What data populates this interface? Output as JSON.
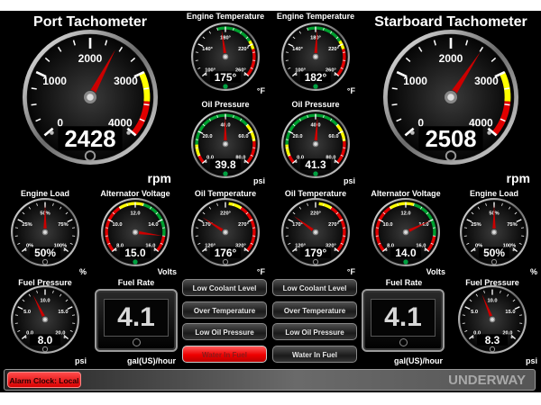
{
  "gauges": [
    {
      "id": "port-tachometer",
      "title": "Port Tachometer",
      "unit": "rpm",
      "min": 0,
      "max": 4000,
      "labels": [
        "0",
        "1000",
        "2000",
        "3000",
        "4000"
      ],
      "value": 2428,
      "readout": "2428",
      "indicator": "off",
      "bands": [
        {
          "from": 3000,
          "to": 3450,
          "color": "#ffff00"
        },
        {
          "from": 3450,
          "to": 4000,
          "color": "#e00000"
        }
      ]
    },
    {
      "id": "starboard-tachometer",
      "title": "Starboard Tachometer",
      "unit": "rpm",
      "min": 0,
      "max": 4000,
      "labels": [
        "0",
        "1000",
        "2000",
        "3000",
        "4000"
      ],
      "value": 2508,
      "readout": "2508",
      "indicator": "off",
      "bands": [
        {
          "from": 3000,
          "to": 3450,
          "color": "#ffff00"
        },
        {
          "from": 3450,
          "to": 4000,
          "color": "#e00000"
        }
      ]
    },
    {
      "id": "port-engine-temperature",
      "title": "Engine Temperature",
      "unit": "°F",
      "min": 100,
      "max": 260,
      "labels": [
        "100°",
        "140°",
        "180°",
        "220°",
        "260°"
      ],
      "value": 175,
      "readout": "175°",
      "indicator": "green",
      "bands": [
        {
          "from": 170,
          "to": 215,
          "color": "#00a030"
        },
        {
          "from": 215,
          "to": 226,
          "color": "#ffff00"
        },
        {
          "from": 226,
          "to": 260,
          "color": "#e00000"
        }
      ]
    },
    {
      "id": "starboard-engine-temperature",
      "title": "Engine Temperature",
      "unit": "°F",
      "min": 100,
      "max": 260,
      "labels": [
        "100°",
        "140°",
        "180°",
        "220°",
        "260°"
      ],
      "value": 182,
      "readout": "182°",
      "indicator": "green",
      "bands": [
        {
          "from": 170,
          "to": 215,
          "color": "#00a030"
        },
        {
          "from": 215,
          "to": 226,
          "color": "#ffff00"
        },
        {
          "from": 226,
          "to": 260,
          "color": "#e00000"
        }
      ]
    },
    {
      "id": "port-oil-pressure",
      "title": "Oil Pressure",
      "unit": "psi",
      "min": 0,
      "max": 80,
      "labels": [
        "0.0",
        "20.0",
        "40.0",
        "60.0",
        "80.0"
      ],
      "value": 39.8,
      "readout": "39.8",
      "indicator": "green",
      "bands": [
        {
          "from": 0,
          "to": 5,
          "color": "#e00000"
        },
        {
          "from": 5,
          "to": 12,
          "color": "#ffff00"
        },
        {
          "from": 12,
          "to": 55,
          "color": "#00a030"
        },
        {
          "from": 55,
          "to": 66,
          "color": "#ffff00"
        },
        {
          "from": 66,
          "to": 80,
          "color": "#e00000"
        }
      ]
    },
    {
      "id": "starboard-oil-pressure",
      "title": "Oil Pressure",
      "unit": "psi",
      "min": 0,
      "max": 80,
      "labels": [
        "0.0",
        "20.0",
        "40.0",
        "60.0",
        "80.0"
      ],
      "value": 41.3,
      "readout": "41.3",
      "indicator": "green",
      "bands": [
        {
          "from": 0,
          "to": 5,
          "color": "#e00000"
        },
        {
          "from": 5,
          "to": 12,
          "color": "#ffff00"
        },
        {
          "from": 12,
          "to": 55,
          "color": "#00a030"
        },
        {
          "from": 55,
          "to": 66,
          "color": "#ffff00"
        },
        {
          "from": 66,
          "to": 80,
          "color": "#e00000"
        }
      ]
    },
    {
      "id": "port-engine-load",
      "title": "Engine Load",
      "unit": "%",
      "min": 0,
      "max": 100,
      "labels": [
        "0%",
        "25%",
        "50%",
        "75%",
        "100%"
      ],
      "value": 50,
      "readout": "50%",
      "indicator": "off",
      "bands": []
    },
    {
      "id": "port-alternator-voltage",
      "title": "Alternator Voltage",
      "unit": "Volts",
      "min": 8,
      "max": 16,
      "labels": [
        "8.0",
        "10.0",
        "12.0",
        "14.0",
        "16.0"
      ],
      "value": 15.0,
      "readout": "15.0",
      "indicator": "green",
      "bands": [
        {
          "from": 8,
          "to": 11,
          "color": "#e00000"
        },
        {
          "from": 11,
          "to": 12.5,
          "color": "#ffff00"
        },
        {
          "from": 12.5,
          "to": 15,
          "color": "#00a030"
        },
        {
          "from": 15,
          "to": 16,
          "color": "#e00000"
        }
      ]
    },
    {
      "id": "port-oil-temperature",
      "title": "Oil Temperature",
      "unit": "°F",
      "min": 120,
      "max": 320,
      "labels": [
        "120°",
        "170°",
        "220°",
        "270°",
        "320°"
      ],
      "value": 176,
      "readout": "176°",
      "indicator": "off",
      "bands": [
        {
          "from": 225,
          "to": 245,
          "color": "#ffff00"
        },
        {
          "from": 245,
          "to": 320,
          "color": "#e00000"
        }
      ]
    },
    {
      "id": "starboard-oil-temperature",
      "title": "Oil Temperature",
      "unit": "°F",
      "min": 120,
      "max": 320,
      "labels": [
        "120°",
        "170°",
        "220°",
        "270°",
        "320°"
      ],
      "value": 179,
      "readout": "179°",
      "indicator": "off",
      "bands": [
        {
          "from": 225,
          "to": 245,
          "color": "#ffff00"
        },
        {
          "from": 245,
          "to": 320,
          "color": "#e00000"
        }
      ]
    },
    {
      "id": "starboard-alternator-voltage",
      "title": "Alternator Voltage",
      "unit": "Volts",
      "min": 8,
      "max": 16,
      "labels": [
        "8.0",
        "10.0",
        "12.0",
        "14.0",
        "16.0"
      ],
      "value": 14.0,
      "readout": "14.0",
      "indicator": "green",
      "bands": [
        {
          "from": 8,
          "to": 11,
          "color": "#e00000"
        },
        {
          "from": 11,
          "to": 12.5,
          "color": "#ffff00"
        },
        {
          "from": 12.5,
          "to": 15,
          "color": "#00a030"
        },
        {
          "from": 15,
          "to": 16,
          "color": "#e00000"
        }
      ]
    },
    {
      "id": "starboard-engine-load",
      "title": "Engine Load",
      "unit": "%",
      "min": 0,
      "max": 100,
      "labels": [
        "0%",
        "25%",
        "50%",
        "75%",
        "100%"
      ],
      "value": 50,
      "readout": "50%",
      "indicator": "off",
      "bands": []
    },
    {
      "id": "port-fuel-pressure",
      "title": "Fuel Pressure",
      "unit": "psi",
      "min": 0,
      "max": 20,
      "labels": [
        "0.0",
        "5.0",
        "10.0",
        "15.0",
        "20.0"
      ],
      "value": 8.0,
      "readout": "8.0",
      "indicator": "off",
      "bands": []
    },
    {
      "id": "starboard-fuel-pressure",
      "title": "Fuel Pressure",
      "unit": "psi",
      "min": 0,
      "max": 20,
      "labels": [
        "0.0",
        "5.0",
        "10.0",
        "15.0",
        "20.0"
      ],
      "value": 8.3,
      "readout": "8.3",
      "indicator": "off",
      "bands": []
    }
  ],
  "fuel_rate": [
    {
      "title": "Fuel Rate",
      "value": "4.1",
      "unit": "gal(US)/hour"
    },
    {
      "title": "Fuel Rate",
      "value": "4.1",
      "unit": "gal(US)/hour"
    }
  ],
  "alarms": {
    "port": [
      {
        "label": "Low Coolant Level",
        "active": false
      },
      {
        "label": "Over Temperature",
        "active": false
      },
      {
        "label": "Low Oil Pressure",
        "active": false
      },
      {
        "label": "Water In Fuel",
        "active": true
      }
    ],
    "starboard": [
      {
        "label": "Low Coolant Level",
        "active": false
      },
      {
        "label": "Over Temperature",
        "active": false
      },
      {
        "label": "Low Oil Pressure",
        "active": false
      },
      {
        "label": "Water In Fuel",
        "active": false
      }
    ]
  },
  "status_bar": {
    "alarm_clock_label": "Alarm Clock: Local",
    "mode": "UNDERWAY"
  },
  "colors": {
    "alarm_active": "#ff0000",
    "needle": "#cc0000",
    "ok_indicator": "#00a040"
  }
}
